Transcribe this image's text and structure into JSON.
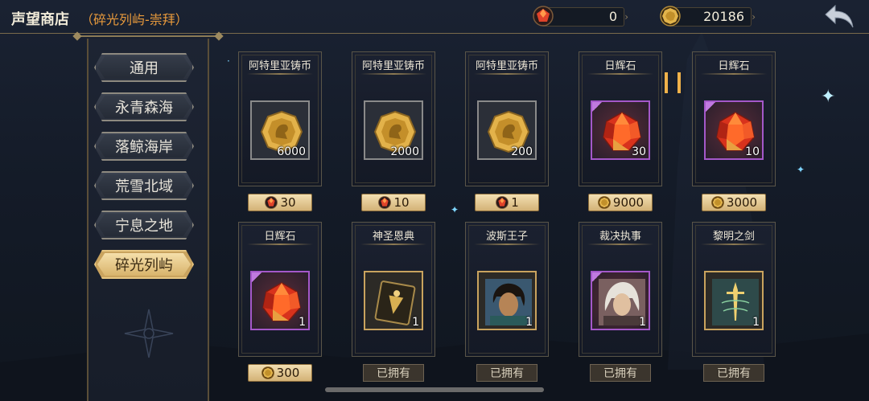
{
  "header": {
    "title": "声望商店",
    "subtitle": "（碎光列屿-崇拜）",
    "currency_red": "0",
    "currency_gold": "20186"
  },
  "nav": [
    {
      "label": "通用",
      "active": false
    },
    {
      "label": "永青森海",
      "active": false
    },
    {
      "label": "落鲸海岸",
      "active": false
    },
    {
      "label": "荒雪北域",
      "active": false
    },
    {
      "label": "宁息之地",
      "active": false
    },
    {
      "label": "碎光列屿",
      "active": true
    }
  ],
  "items": [
    {
      "name": "阿特里亚铸币",
      "qty": "6000",
      "icon": "gold-coin-icon",
      "rarity": "gray",
      "price": "30",
      "price_icon": "red-gem-icon",
      "owned": false
    },
    {
      "name": "阿特里亚铸币",
      "qty": "2000",
      "icon": "gold-coin-icon",
      "rarity": "gray",
      "price": "10",
      "price_icon": "red-gem-icon",
      "owned": false
    },
    {
      "name": "阿特里亚铸币",
      "qty": "200",
      "icon": "gold-coin-icon",
      "rarity": "gray",
      "price": "1",
      "price_icon": "red-gem-icon",
      "owned": false
    },
    {
      "name": "日辉石",
      "qty": "30",
      "icon": "sunstone-icon",
      "rarity": "purple",
      "price": "9000",
      "price_icon": "gold-coin-icon",
      "owned": false
    },
    {
      "name": "日辉石",
      "qty": "10",
      "icon": "sunstone-icon",
      "rarity": "purple",
      "price": "3000",
      "price_icon": "gold-coin-icon",
      "owned": false
    },
    {
      "name": "日辉石",
      "qty": "1",
      "icon": "sunstone-icon",
      "rarity": "purple",
      "price": "300",
      "price_icon": "gold-coin-icon",
      "owned": false
    },
    {
      "name": "神圣恩典",
      "qty": "1",
      "icon": "holy-grace-card-icon",
      "rarity": "gold",
      "price": "已拥有",
      "owned": true
    },
    {
      "name": "波斯王子",
      "qty": "1",
      "icon": "prince-portrait-icon",
      "rarity": "gold",
      "price": "已拥有",
      "owned": true
    },
    {
      "name": "裁决执事",
      "qty": "1",
      "icon": "judgment-deacon-portrait-icon",
      "rarity": "purple",
      "price": "已拥有",
      "owned": true
    },
    {
      "name": "黎明之剑",
      "qty": "1",
      "icon": "dawn-sword-icon",
      "rarity": "gold",
      "price": "已拥有",
      "owned": true
    }
  ],
  "colors": {
    "accent_orange": "#e89a3c",
    "gold_button": "#d3b276",
    "purple_rarity": "#a458c9"
  }
}
